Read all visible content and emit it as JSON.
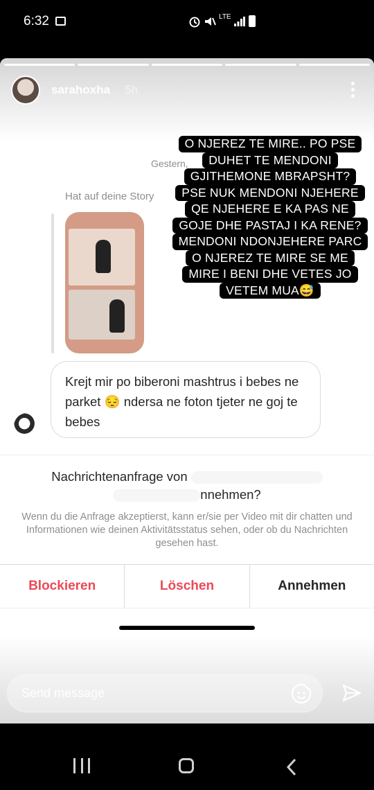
{
  "status_bar": {
    "time": "6:32",
    "network": "LTE"
  },
  "story": {
    "username": "sarahoxha",
    "age": "5h",
    "overlay_lines": [
      "O NJEREZ TE MIRE.. PO PSE",
      "DUHET TE MENDONI",
      "GJITHEMONE MBRAPSHT?",
      "PSE NUK MENDONI NJEHERE",
      "QE NJEHERE E KA PAS NE",
      "GOJE DHE PASTAJ I KA RENE?",
      "MENDONI NDONJEHERE PARC",
      "O NJEREZ TE MIRE SE ME",
      "MIRE I BENI DHE VETES JO",
      "VETEM MUA😅"
    ]
  },
  "conversation": {
    "date_label": "Gestern,",
    "reply_label": "Hat auf deine Story",
    "message": "Krejt mir po biberoni mashtrus i bebes ne parket 😔 ndersa ne foton tjeter ne goj te bebes"
  },
  "request": {
    "title_start": "Nachrichtenanfrage von",
    "title_end": "nnehmen?",
    "description": "Wenn du die Anfrage akzeptierst, kann er/sie per Video mit dir chatten und Informationen wie deinen Aktivitätsstatus sehen, oder ob du Nachrichten gesehen hast."
  },
  "actions": {
    "block": "Blockieren",
    "delete": "Löschen",
    "accept": "Annehmen"
  },
  "composer": {
    "placeholder": "Send message"
  },
  "icons": [
    "gallery-icon",
    "alarm-icon",
    "mute-icon",
    "signal-icon",
    "battery-icon",
    "more-icon",
    "sticker-icon",
    "send-icon",
    "recents-icon",
    "home-icon",
    "back-icon"
  ],
  "colors": {
    "destructive": "#ed4956",
    "text": "#262626",
    "secondary": "#8e8e8e"
  }
}
